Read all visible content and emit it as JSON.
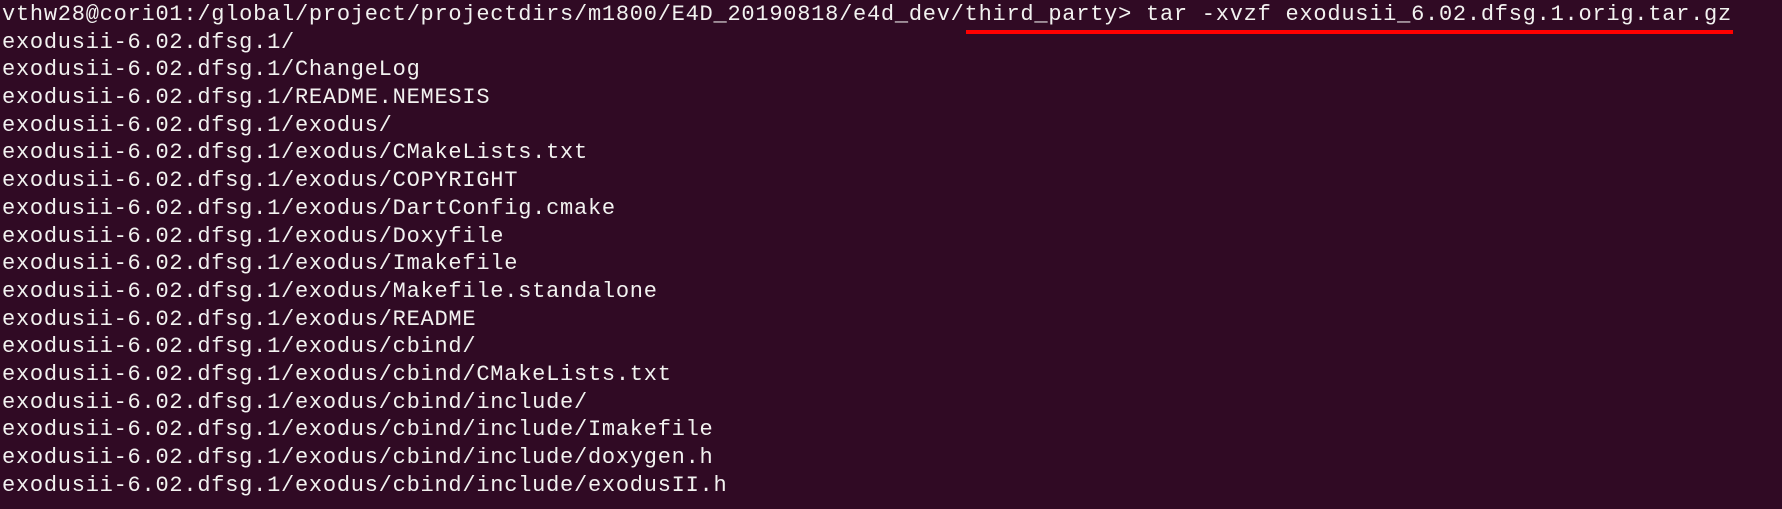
{
  "terminal": {
    "prompt": "vthw28@cori01:/global/project/projectdirs/m1800/E4D_20190818/e4d_dev/third_party> ",
    "command": "tar -xvzf exodusii_6.02.dfsg.1.orig.tar.gz",
    "output": [
      "exodusii-6.02.dfsg.1/",
      "exodusii-6.02.dfsg.1/ChangeLog",
      "exodusii-6.02.dfsg.1/README.NEMESIS",
      "exodusii-6.02.dfsg.1/exodus/",
      "exodusii-6.02.dfsg.1/exodus/CMakeLists.txt",
      "exodusii-6.02.dfsg.1/exodus/COPYRIGHT",
      "exodusii-6.02.dfsg.1/exodus/DartConfig.cmake",
      "exodusii-6.02.dfsg.1/exodus/Doxyfile",
      "exodusii-6.02.dfsg.1/exodus/Imakefile",
      "exodusii-6.02.dfsg.1/exodus/Makefile.standalone",
      "exodusii-6.02.dfsg.1/exodus/README",
      "exodusii-6.02.dfsg.1/exodus/cbind/",
      "exodusii-6.02.dfsg.1/exodus/cbind/CMakeLists.txt",
      "exodusii-6.02.dfsg.1/exodus/cbind/include/",
      "exodusii-6.02.dfsg.1/exodus/cbind/include/Imakefile",
      "exodusii-6.02.dfsg.1/exodus/cbind/include/doxygen.h",
      "exodusii-6.02.dfsg.1/exodus/cbind/include/exodusII.h"
    ]
  },
  "colors": {
    "background": "#300a24",
    "text": "#f2f2f0",
    "annotation": "#ff0000"
  }
}
